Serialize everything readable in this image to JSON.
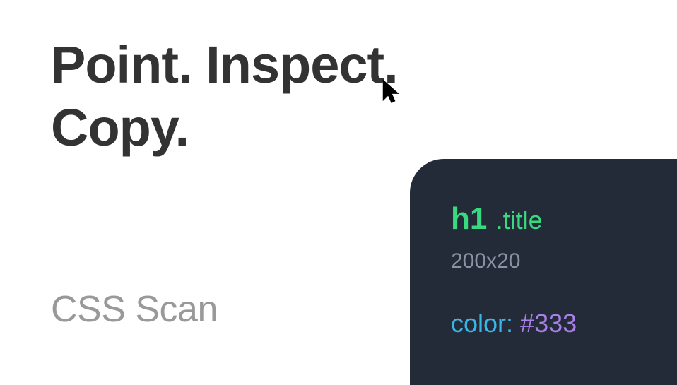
{
  "hero": {
    "title_line1": "Point. Inspect.",
    "title_line2": "Copy."
  },
  "subtitle": "CSS Scan",
  "inspector": {
    "tag": "h1",
    "class": ".title",
    "dimensions": "200x20",
    "property": "color",
    "value": "#333"
  }
}
